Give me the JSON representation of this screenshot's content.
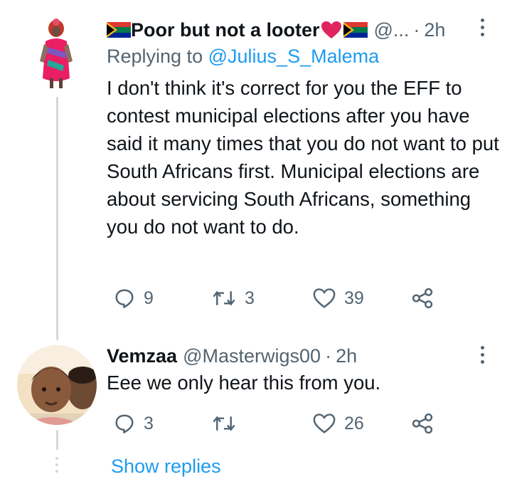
{
  "tweet1": {
    "display_name": "Poor but not a looter",
    "handle_truncated": "@...",
    "separator": "·",
    "time": "2h",
    "replying_prefix": "Replying to",
    "replying_handle": "@Julius_S_Malema",
    "body": "I don't think it's correct for you the EFF to contest municipal elections after you have said it many times that you do not want to put South Africans first. Municipal elections are about servicing South Africans, something you do not want to do.",
    "reply_count": "9",
    "retweet_count": "3",
    "like_count": "39"
  },
  "tweet2": {
    "display_name": "Vemzaa",
    "handle": "@Masterwigs00",
    "separator": "·",
    "time": "2h",
    "body": "Eee we only hear this from you.",
    "reply_count": "3",
    "like_count": "26"
  },
  "show_replies": "Show replies",
  "colors": {
    "text": "#0f1419",
    "secondary": "#536471",
    "link": "#1d9bf0",
    "thread_line": "#cfd9de",
    "heart": "#e0245e"
  },
  "icons": [
    "flag-icon",
    "heart-emoji-icon",
    "more-icon",
    "reply-icon",
    "retweet-icon",
    "like-icon",
    "share-icon"
  ]
}
